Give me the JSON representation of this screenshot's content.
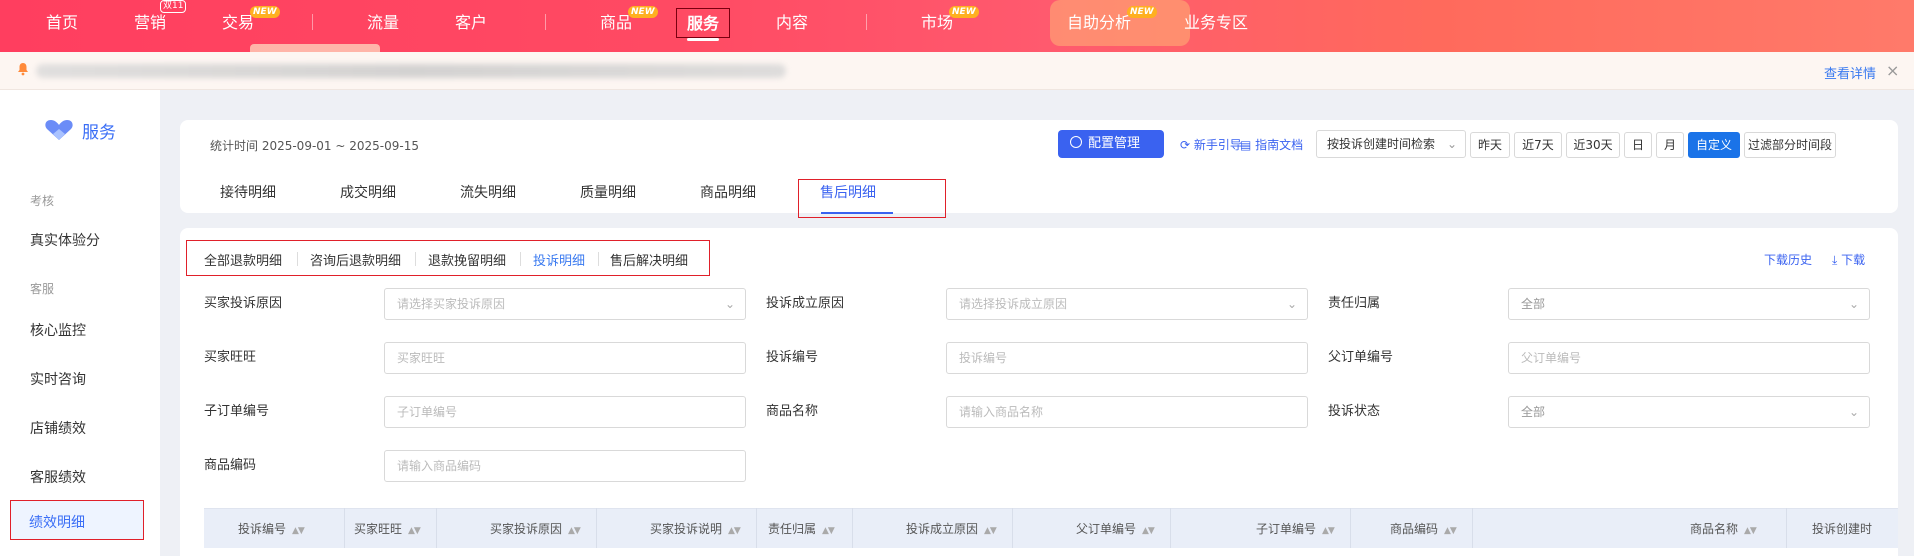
{
  "nav": {
    "items": [
      {
        "label": "首页"
      },
      {
        "label": "营销",
        "badge": "双11"
      },
      {
        "label": "交易",
        "badge": "NEW"
      },
      {
        "label": "流量"
      },
      {
        "label": "客户"
      },
      {
        "label": "商品",
        "badge": "NEW"
      },
      {
        "label": "服务"
      },
      {
        "label": "内容"
      },
      {
        "label": "市场",
        "badge": "NEW"
      },
      {
        "label": "自助分析",
        "badge": "NEW"
      },
      {
        "label": "业务专区"
      }
    ],
    "active": "服务"
  },
  "notice": {
    "detail_link": "查看详情",
    "close": "×"
  },
  "sidebar": {
    "title": "服务",
    "groups": [
      {
        "label": "考核"
      },
      {
        "label": "客服"
      }
    ],
    "items": [
      {
        "label": "真实体验分"
      },
      {
        "label": "核心监控"
      },
      {
        "label": "实时咨询"
      },
      {
        "label": "店铺绩效"
      },
      {
        "label": "客服绩效"
      },
      {
        "label": "绩效明细"
      }
    ],
    "active": "绩效明细"
  },
  "header": {
    "stat_time": "统计时间 2025-09-01 ~ 2025-09-15",
    "config_button": "配置管理",
    "guide_link": "新手引导",
    "doc_link": "指南文档",
    "search_select": "按投诉创建时间检索",
    "date_buttons": [
      "昨天",
      "近7天",
      "近30天",
      "日",
      "月",
      "自定义",
      "过滤部分时间段"
    ],
    "date_active": "自定义"
  },
  "tabs": [
    "接待明细",
    "成交明细",
    "流失明细",
    "质量明细",
    "商品明细",
    "售后明细"
  ],
  "tabs_active": "售后明细",
  "subtabs": [
    "全部退款明细",
    "咨询后退款明细",
    "退款挽留明细",
    "投诉明细",
    "售后解决明细"
  ],
  "subtabs_active": "投诉明细",
  "download": {
    "history": "下载历史",
    "download": "下载"
  },
  "filters": [
    {
      "label": "买家投诉原因",
      "placeholder": "请选择买家投诉原因",
      "select": true
    },
    {
      "label": "投诉成立原因",
      "placeholder": "请选择投诉成立原因",
      "select": true
    },
    {
      "label": "责任归属",
      "placeholder": "全部",
      "select": true
    },
    {
      "label": "买家旺旺",
      "placeholder": "买家旺旺"
    },
    {
      "label": "投诉编号",
      "placeholder": "投诉编号"
    },
    {
      "label": "父订单编号",
      "placeholder": "父订单编号"
    },
    {
      "label": "子订单编号",
      "placeholder": "子订单编号"
    },
    {
      "label": "商品名称",
      "placeholder": "请输入商品名称"
    },
    {
      "label": "投诉状态",
      "placeholder": "全部",
      "select": true
    },
    {
      "label": "商品编码",
      "placeholder": "请输入商品编码"
    }
  ],
  "table": {
    "headers": [
      "投诉编号",
      "买家旺旺",
      "买家投诉原因",
      "买家投诉说明",
      "责任归属",
      "投诉成立原因",
      "父订单编号",
      "子订单编号",
      "商品编码",
      "商品名称",
      "投诉创建时"
    ]
  },
  "icons": {
    "sort": "sort-icon",
    "chevron": "chevron-down-icon",
    "bell": "bell-icon",
    "download": "download-icon"
  },
  "colors": {
    "accent": "#3a62f0",
    "nav": "#ff4a63",
    "highlight": "#e0202a",
    "active_btn": "#1a73e8"
  }
}
